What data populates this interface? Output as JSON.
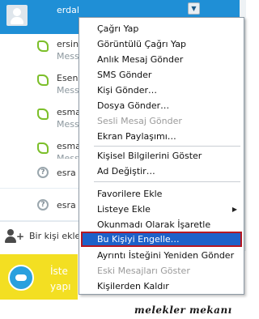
{
  "contacts": [
    {
      "name": "erdal",
      "message": "",
      "status": "online",
      "selected": true
    },
    {
      "name": "ersin",
      "message": "Messe",
      "status": "online"
    },
    {
      "name": "Esen",
      "message": "Messe",
      "status": "online"
    },
    {
      "name": "esma",
      "message": "Messe",
      "status": "online"
    },
    {
      "name": "esma",
      "message": "Messe",
      "status": "online"
    },
    {
      "name": "esra",
      "message": "",
      "status": "unknown"
    },
    {
      "name": "esra",
      "message": "",
      "status": "unknown"
    }
  ],
  "row_arrow_glyph": "▼",
  "unknown_status_glyph": "?",
  "add_contact": {
    "label": "Bir kişi ekle",
    "icon": "add-person-icon",
    "plus": "+"
  },
  "promo": {
    "line1": "İste",
    "line2": "yapı"
  },
  "watermark": "melekler mekanı",
  "context_menu": {
    "items": [
      {
        "label": "Çağrı Yap",
        "state": "enabled"
      },
      {
        "label": "Görüntülü Çağrı Yap",
        "state": "enabled"
      },
      {
        "label": "Anlık Mesaj Gönder",
        "state": "enabled"
      },
      {
        "label": "SMS Gönder",
        "state": "enabled"
      },
      {
        "label": "Kişi Gönder…",
        "state": "enabled"
      },
      {
        "label": "Dosya Gönder…",
        "state": "enabled"
      },
      {
        "label": "Sesli Mesaj Gönder",
        "state": "disabled"
      },
      {
        "label": "Ekran Paylaşımı…",
        "state": "enabled"
      },
      {
        "label": "Kişisel Bilgilerini Göster",
        "state": "enabled"
      },
      {
        "label": "Ad Değiştir…",
        "state": "enabled"
      },
      {
        "label": "Favorilere Ekle",
        "state": "enabled"
      },
      {
        "label": "Listeye Ekle",
        "state": "enabled",
        "submenu": true
      },
      {
        "label": "Okunmadı Olarak İşaretle",
        "state": "enabled"
      },
      {
        "label": "Bu Kişiyi Engelle…",
        "state": "highlighted"
      },
      {
        "label": "Ayrıntı İsteğini Yeniden Gönder",
        "state": "enabled"
      },
      {
        "label": "Eski Mesajları Göster",
        "state": "disabled"
      },
      {
        "label": "Kişilerden Kaldır",
        "state": "enabled"
      }
    ],
    "submenu_glyph": "▶"
  },
  "colors": {
    "selected_row": "#1f8fd6",
    "highlight": "#1d61c9",
    "highlight_border": "#b61822",
    "online_status": "#7cbf2a",
    "promo_bg": "#f3df22"
  }
}
